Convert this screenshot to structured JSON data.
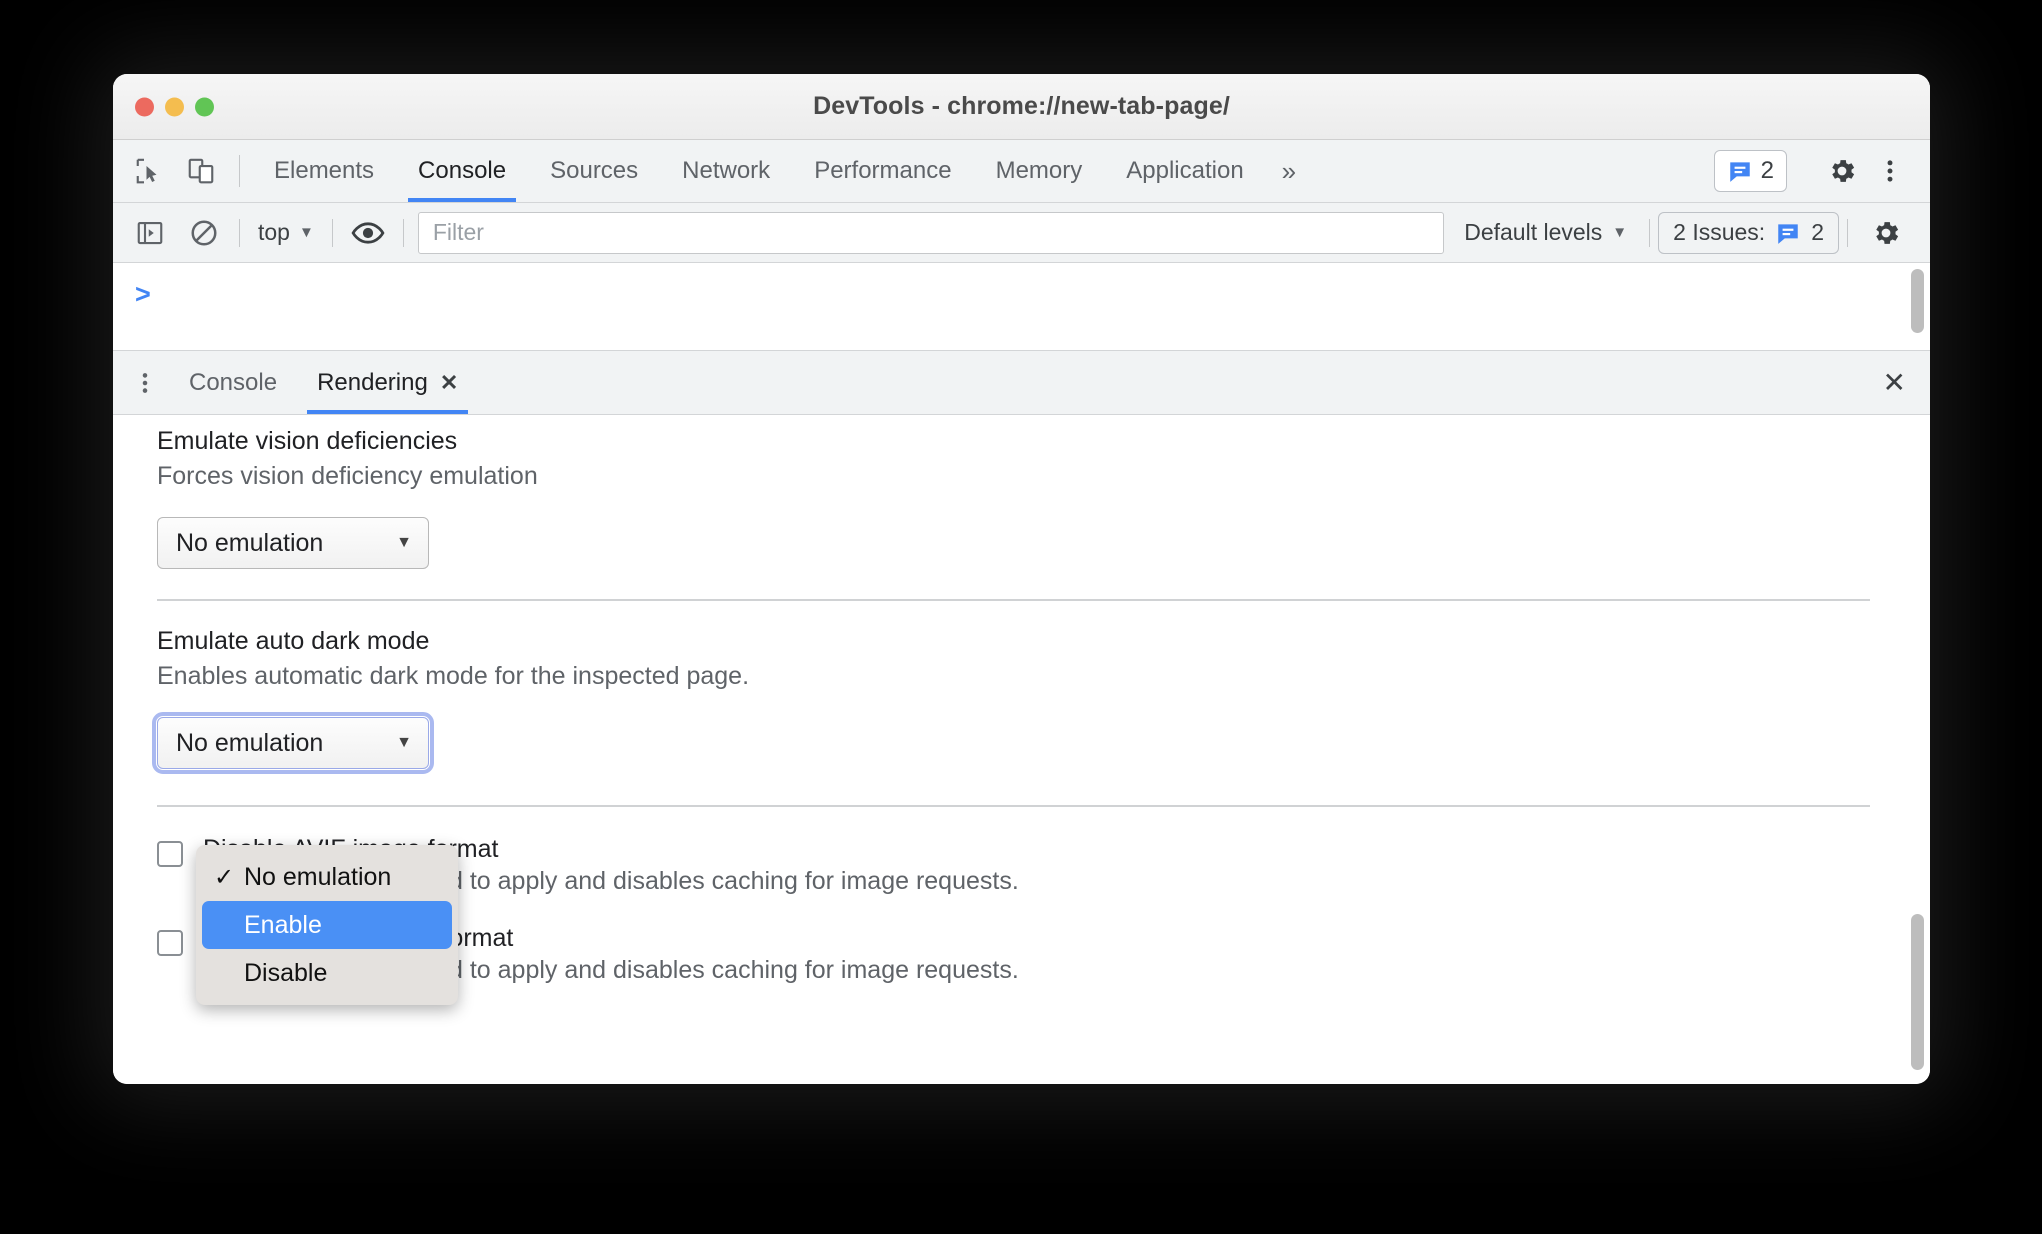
{
  "window": {
    "title": "DevTools - chrome://new-tab-page/",
    "traffic_lights": [
      "close-red",
      "minimize-yellow",
      "zoom-green"
    ],
    "colors": {
      "accent": "#4285f4",
      "menu_highlight": "#4a90f5",
      "panel_bg": "#f1f3f4"
    }
  },
  "main_tabbar": {
    "inspect_icon": "inspect-element-icon",
    "device_icon": "device-toolbar-icon",
    "tabs": [
      {
        "label": "Elements",
        "active": false
      },
      {
        "label": "Console",
        "active": true
      },
      {
        "label": "Sources",
        "active": false
      },
      {
        "label": "Network",
        "active": false
      },
      {
        "label": "Performance",
        "active": false
      },
      {
        "label": "Memory",
        "active": false
      },
      {
        "label": "Application",
        "active": false
      }
    ],
    "more_tabs_icon": "chevron-double-right-icon",
    "issues_count": "2",
    "settings_icon": "gear-icon",
    "menu_icon": "kebab-menu-icon"
  },
  "console_toolbar": {
    "sidebar_icon": "console-sidebar-icon",
    "clear_icon": "clear-console-icon",
    "context_label": "top",
    "context_caret": "▼",
    "eye_icon": "live-expression-eye-icon",
    "filter_placeholder": "Filter",
    "filter_value": "",
    "levels_label": "Default levels",
    "levels_caret": "▼",
    "issues_label": "2 Issues:",
    "issues_count": "2",
    "settings_icon": "gear-icon"
  },
  "console_output": {
    "prompt": ">"
  },
  "drawer": {
    "kebab_icon": "kebab-menu-icon",
    "tabs": [
      {
        "label": "Console",
        "active": false,
        "closable": false
      },
      {
        "label": "Rendering",
        "active": true,
        "closable": true,
        "close_glyph": "✕"
      }
    ],
    "close_glyph": "✕"
  },
  "rendering": {
    "settings": [
      {
        "title": "Emulate vision deficiencies",
        "subtitle": "Forces vision deficiency emulation",
        "select_value": "No emulation",
        "caret": "▼",
        "focused": false
      },
      {
        "title": "Emulate auto dark mode",
        "subtitle": "Enables automatic dark mode for the inspected page.",
        "select_value": "No emulation",
        "caret": "▼",
        "focused": true
      }
    ],
    "checkboxes": [
      {
        "title": "Disable AVIF image format",
        "subtitle": "Requires a page reload to apply and disables caching for image requests.",
        "checked": false
      },
      {
        "title": "Disable WebP image format",
        "subtitle": "Requires a page reload to apply and disables caching for image requests.",
        "checked": false
      }
    ]
  },
  "dropdown_menu": {
    "open": true,
    "options": [
      {
        "label": "No emulation",
        "checked": true,
        "highlighted": false,
        "tick": "✓"
      },
      {
        "label": "Enable",
        "checked": false,
        "highlighted": true,
        "tick": ""
      },
      {
        "label": "Disable",
        "checked": false,
        "highlighted": false,
        "tick": ""
      }
    ]
  }
}
